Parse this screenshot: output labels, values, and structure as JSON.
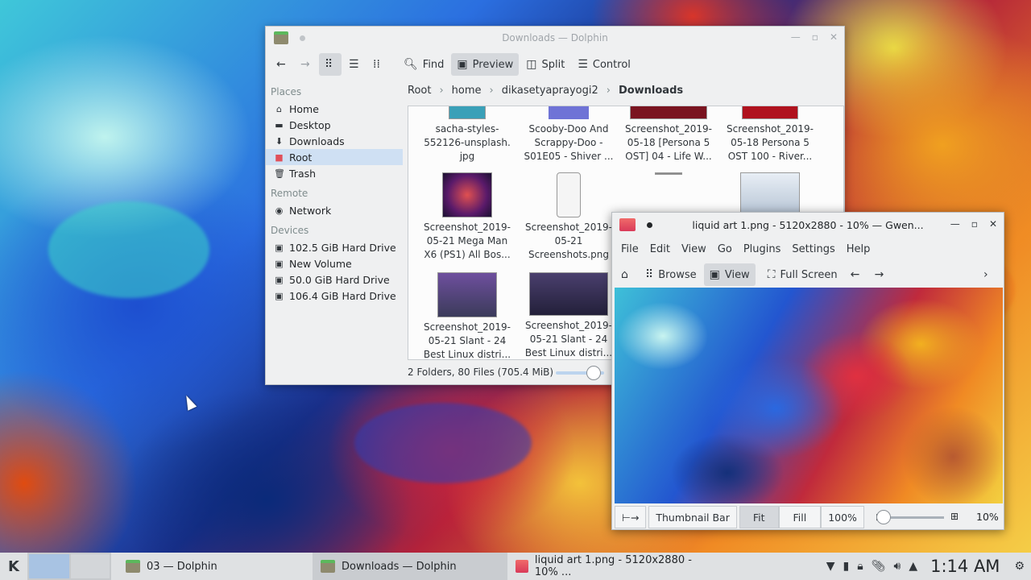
{
  "dolphin": {
    "title": "Downloads — Dolphin",
    "toolbar": {
      "find": "Find",
      "preview": "Preview",
      "split": "Split",
      "control": "Control"
    },
    "sidebar": {
      "places_header": "Places",
      "places": [
        "Home",
        "Desktop",
        "Downloads",
        "Root",
        "Trash"
      ],
      "remote_header": "Remote",
      "remote": [
        "Network"
      ],
      "devices_header": "Devices",
      "devices": [
        "102.5 GiB Hard Drive",
        "New Volume",
        "50.0 GiB Hard Drive",
        "106.4 GiB Hard Drive"
      ]
    },
    "breadcrumb": [
      "Root",
      "home",
      "dikasetyaprayogi2",
      "Downloads"
    ],
    "files": [
      {
        "l1": "sacha-styles-",
        "l2": "552126-unsplash.",
        "l3": "jpg"
      },
      {
        "l1": "Scooby-Doo And",
        "l2": "Scrappy-Doo -",
        "l3": "S01E05 - Shiver ..."
      },
      {
        "l1": "Screenshot_2019-",
        "l2": "05-18 [Persona 5",
        "l3": "OST] 04 - Life W..."
      },
      {
        "l1": "Screenshot_2019-",
        "l2": "05-18 Persona 5",
        "l3": "OST 100 - River..."
      },
      {
        "l1": "Screenshot_2019-",
        "l2": "05-21 Mega Man",
        "l3": "X6 (PS1) All Bos..."
      },
      {
        "l1": "Screenshot_2019-",
        "l2": "05-21",
        "l3": "Screenshots.png"
      },
      {
        "l1": "Screenshot_2019-",
        "l2": "05-21 Slant - 24",
        "l3": "Best Linux distri..."
      },
      {
        "l1": "Screenshot_2019-",
        "l2": "05-21 Slant - 24",
        "l3": "Best Linux distri..."
      }
    ],
    "status": "2 Folders, 80 Files (705.4 MiB)"
  },
  "gwenview": {
    "title": "liquid art 1.png - 5120x2880 - 10% — Gwen...",
    "menu": [
      "File",
      "Edit",
      "View",
      "Go",
      "Plugins",
      "Settings",
      "Help"
    ],
    "toolbar": {
      "browse": "Browse",
      "view": "View",
      "fullscreen": "Full Screen"
    },
    "bottom": {
      "thumbnail_bar": "Thumbnail Bar",
      "fit": "Fit",
      "fill": "Fill",
      "zoom100": "100%",
      "zoom_level": "10%"
    }
  },
  "taskbar": {
    "tasks": [
      "03 — Dolphin",
      "Downloads — Dolphin",
      "liquid art 1.png - 5120x2880 - 10% ..."
    ],
    "clock": "1:14 AM"
  },
  "colors": {
    "selection": "#cfe0f3",
    "panel": "#dfe1e3",
    "window": "#eff0f1"
  }
}
